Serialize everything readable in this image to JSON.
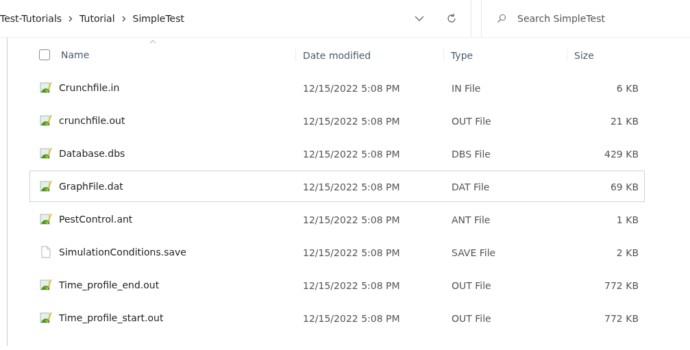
{
  "breadcrumb": [
    "Test-Tutorials",
    "Tutorial",
    "SimpleTest"
  ],
  "search": {
    "placeholder": "Search SimpleTest"
  },
  "columns": [
    "Name",
    "Date modified",
    "Type",
    "Size"
  ],
  "select_all": {
    "checked": false
  },
  "rows": [
    {
      "name": "Crunchfile.in",
      "date": "12/15/2022 5:08 PM",
      "type": "IN File",
      "size": "6 KB",
      "kind": "program",
      "focused": false
    },
    {
      "name": "crunchfile.out",
      "date": "12/15/2022 5:08 PM",
      "type": "OUT File",
      "size": "21 KB",
      "kind": "program",
      "focused": false
    },
    {
      "name": "Database.dbs",
      "date": "12/15/2022 5:08 PM",
      "type": "DBS File",
      "size": "429 KB",
      "kind": "program",
      "focused": false
    },
    {
      "name": "GraphFile.dat",
      "date": "12/15/2022 5:08 PM",
      "type": "DAT File",
      "size": "69 KB",
      "kind": "program",
      "focused": true
    },
    {
      "name": "PestControl.ant",
      "date": "12/15/2022 5:08 PM",
      "type": "ANT File",
      "size": "1 KB",
      "kind": "program",
      "focused": false
    },
    {
      "name": "SimulationConditions.save",
      "date": "12/15/2022 5:08 PM",
      "type": "SAVE File",
      "size": "2 KB",
      "kind": "blank",
      "focused": false
    },
    {
      "name": "Time_profile_end.out",
      "date": "12/15/2022 5:08 PM",
      "type": "OUT File",
      "size": "772 KB",
      "kind": "program",
      "focused": false
    },
    {
      "name": "Time_profile_start.out",
      "date": "12/15/2022 5:08 PM",
      "type": "OUT File",
      "size": "772 KB",
      "kind": "program",
      "focused": false
    }
  ]
}
